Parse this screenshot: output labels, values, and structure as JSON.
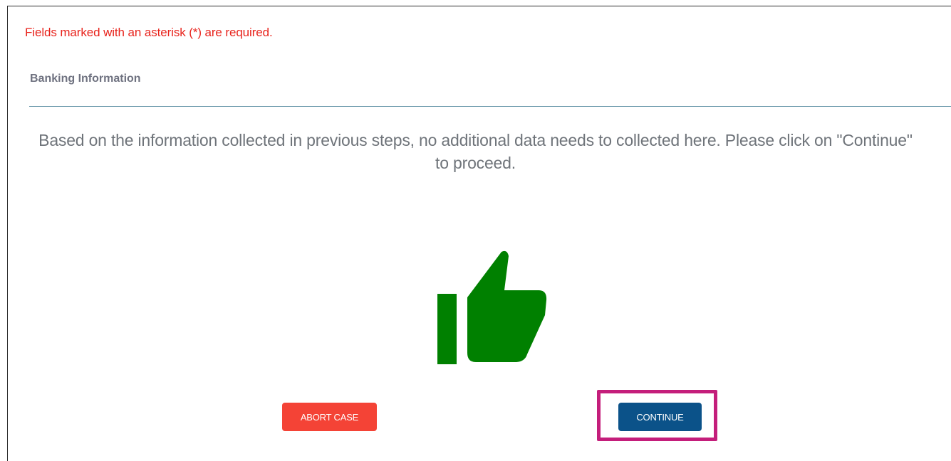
{
  "form": {
    "required_note": "Fields marked with an asterisk (*) are required.",
    "section_title": "Banking Information",
    "message_line1": "Based on the information collected in previous steps, no additional data needs to collected here. Please click on \"Continue\"",
    "message_line2": "to proceed.",
    "icon": "thumbs-up-icon",
    "icon_color": "#008000"
  },
  "actions": {
    "abort_label": "ABORT CASE",
    "abort_color": "#f44336",
    "continue_label": "CONTINUE",
    "continue_color": "#0b5289",
    "highlight_color": "#c41e7b"
  }
}
